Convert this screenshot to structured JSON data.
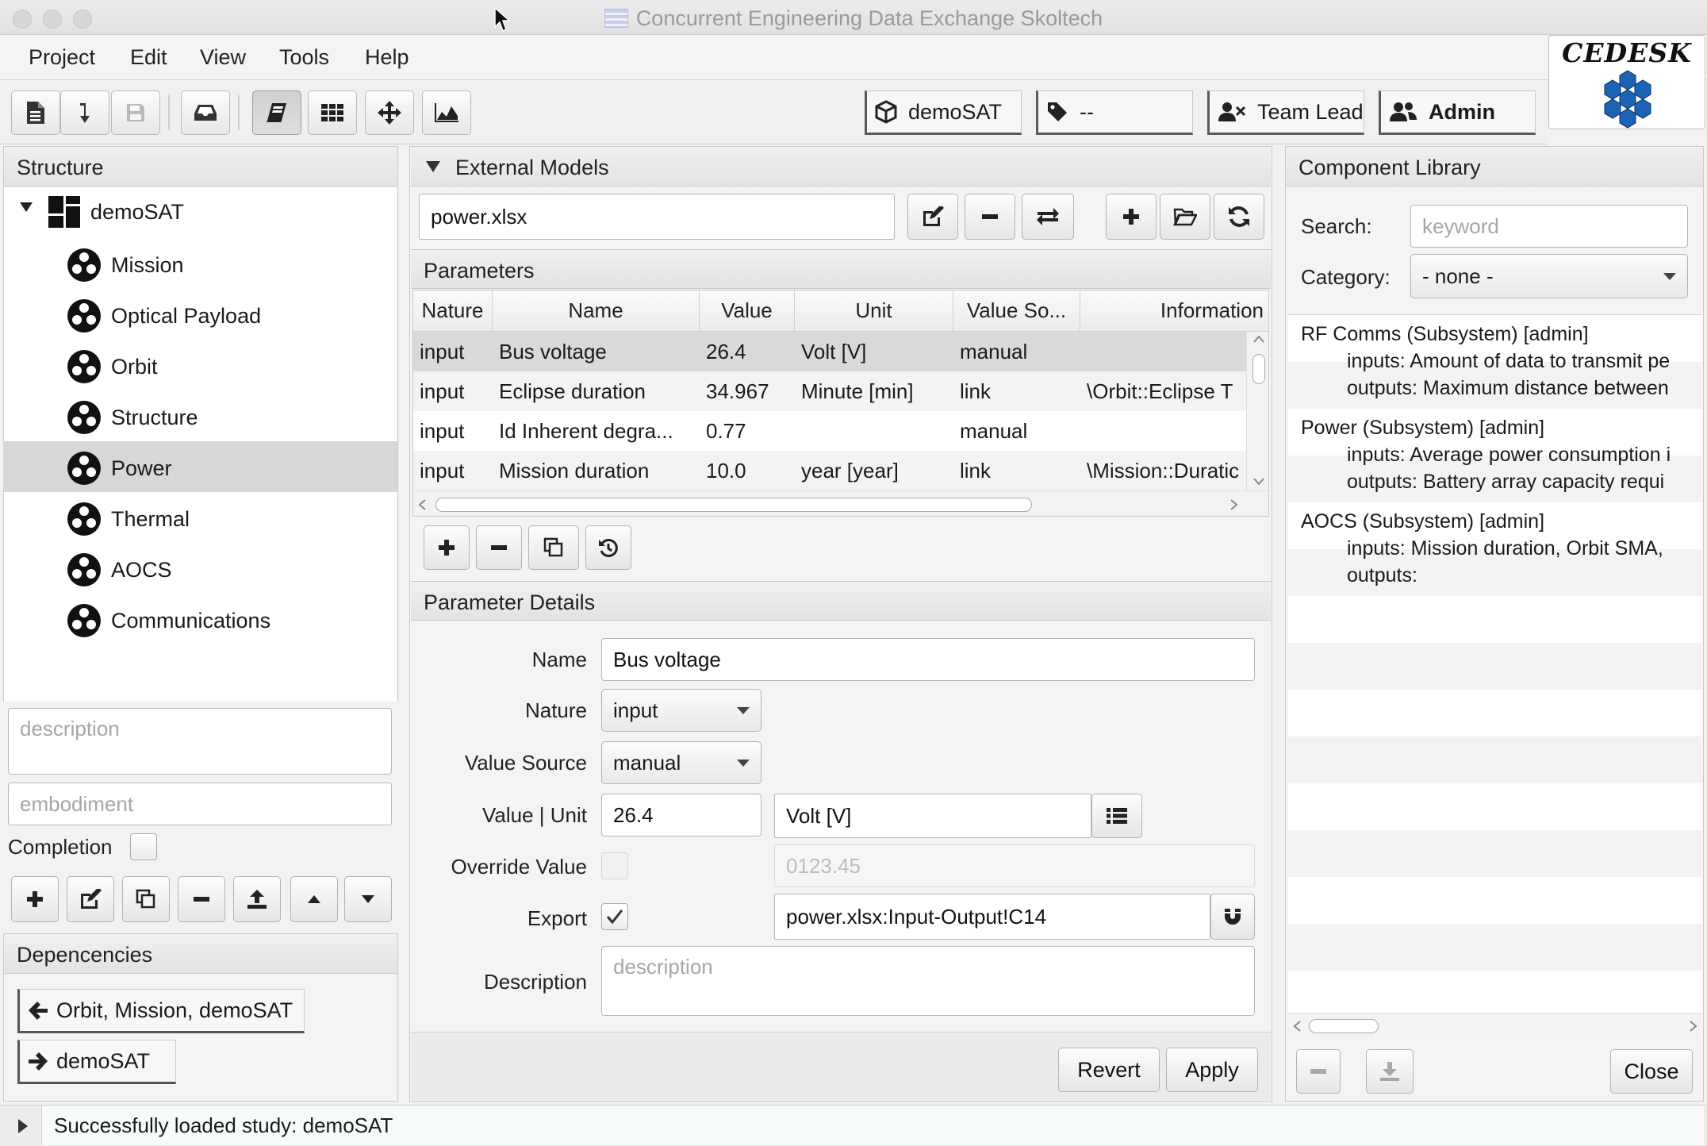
{
  "window": {
    "title": "Concurrent Engineering Data Exchange Skoltech"
  },
  "menu": [
    "Project",
    "Edit",
    "View",
    "Tools",
    "Help"
  ],
  "toolbar": {
    "study": "demoSAT",
    "tag": "--",
    "role": "Team Lead",
    "user": "Admin",
    "logo_text": "CEDESK"
  },
  "structure": {
    "header": "Structure",
    "root": "demoSAT",
    "children": [
      "Mission",
      "Optical Payload",
      "Orbit",
      "Structure",
      "Power",
      "Thermal",
      "AOCS",
      "Communications"
    ],
    "selected": "Power",
    "description_placeholder": "description",
    "embodiment_placeholder": "embodiment",
    "completion_label": "Completion"
  },
  "dependencies": {
    "header": "Depencencies",
    "incoming": "Orbit, Mission, demoSAT",
    "outgoing": "demoSAT"
  },
  "external_models": {
    "header": "External Models",
    "selected_file": "power.xlsx"
  },
  "parameters": {
    "header": "Parameters",
    "columns": [
      "Nature",
      "Name",
      "Value",
      "Unit",
      "Value So...",
      "Information"
    ],
    "rows": [
      {
        "nature": "input",
        "name": "Bus voltage",
        "value": "26.4",
        "unit": "Volt [V]",
        "source": "manual",
        "info": ""
      },
      {
        "nature": "input",
        "name": "Eclipse duration",
        "value": "34.967",
        "unit": "Minute [min]",
        "source": "link",
        "info": "\\Orbit::Eclipse T"
      },
      {
        "nature": "input",
        "name": "Id Inherent degra...",
        "value": "0.77",
        "unit": "",
        "source": "manual",
        "info": ""
      },
      {
        "nature": "input",
        "name": "Mission duration",
        "value": "10.0",
        "unit": "year [year]",
        "source": "link",
        "info": "\\Mission::Duratic"
      }
    ]
  },
  "details": {
    "header": "Parameter Details",
    "name_label": "Name",
    "name_value": "Bus voltage",
    "nature_label": "Nature",
    "nature_value": "input",
    "source_label": "Value Source",
    "source_value": "manual",
    "value_unit_label": "Value | Unit",
    "value": "26.4",
    "unit": "Volt [V]",
    "override_label": "Override Value",
    "override_placeholder": "0123.45",
    "export_label": "Export",
    "export_value": "power.xlsx:Input-Output!C14",
    "export_checked": true,
    "description_label": "Description",
    "description_placeholder": "description",
    "revert": "Revert",
    "apply": "Apply"
  },
  "library": {
    "header": "Component Library",
    "search_label": "Search:",
    "search_placeholder": "keyword",
    "category_label": "Category:",
    "category_value": "- none -",
    "items": [
      {
        "title": "RF Comms (Subsystem) [admin]",
        "inputs": "inputs: Amount of data to transmit pe",
        "outputs": "outputs: Maximum distance between"
      },
      {
        "title": "Power (Subsystem) [admin]",
        "inputs": "inputs: Average power consumption i",
        "outputs": "outputs: Battery array capacity requi"
      },
      {
        "title": "AOCS (Subsystem) [admin]",
        "inputs": "inputs: Mission duration, Orbit SMA,",
        "outputs": "outputs:"
      }
    ],
    "close": "Close"
  },
  "status": {
    "message": "Successfully loaded study: demoSAT"
  },
  "colors": {
    "logo_blue": "#1c63b3",
    "logo_dark": "#0d2f66"
  }
}
